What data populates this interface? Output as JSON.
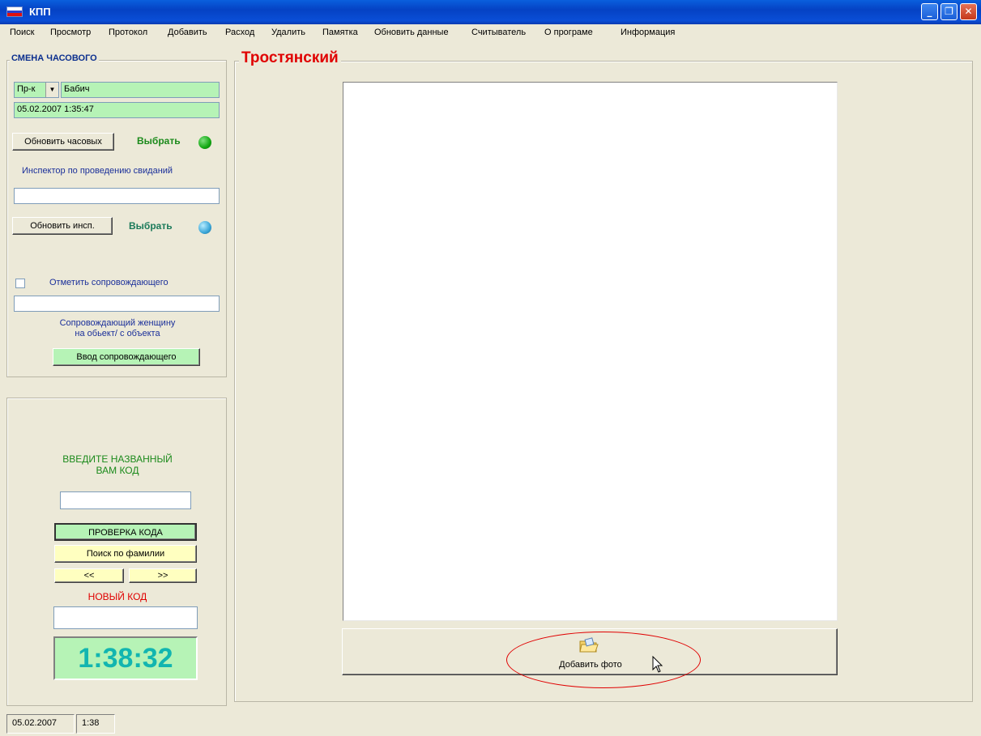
{
  "window": {
    "title": "КПП",
    "flag_colors": [
      "#ffffff",
      "#2b3fd1",
      "#e01010"
    ],
    "controls": {
      "minimize": "_",
      "restore": "❐",
      "close": "✕"
    }
  },
  "menu": [
    "Поиск",
    "Просмотр",
    "Протокол",
    "Добавить",
    "Расход",
    "Удалить",
    "Памятка",
    "Обновить данные",
    "Считыватель",
    "О програме",
    "Информация"
  ],
  "guard_panel": {
    "title": "СМЕНА ЧАСОВОГО",
    "rank_value": "Пр-к",
    "name_value": "Бабич",
    "datetime_value": "05.02.2007 1:35:47",
    "update_guards_button": "Обновить часовых",
    "select_label": "Выбрать",
    "inspector_label": "Инспектор по проведению свиданий",
    "inspector_value": "",
    "update_inspector_button": "Обновить инсп.",
    "select_label_2": "Выбрать",
    "escort_checkbox_label": "Отметить сопровождающего",
    "escort_value": "",
    "escort_note_line1": "Сопровождающий женщину",
    "escort_note_line2": "на обьект/ с объекта",
    "escort_button": "Ввод сопровождающего",
    "led_colors": [
      "#12a812",
      "#3aa6d8"
    ]
  },
  "code_panel": {
    "prompt_line1": "ВВЕДИТЕ НАЗВАННЫЙ",
    "prompt_line2": "ВАМ КОД",
    "code_value": "",
    "check_button": "ПРОВЕРКА КОДА",
    "search_button": "Поиск по фамилии",
    "prev_button": "<<",
    "next_button": ">>",
    "new_code_label": "НОВЫЙ КОД",
    "new_code_value": "",
    "clock": "1:38:32"
  },
  "main": {
    "title": "Тростянский",
    "add_photo_button": "Добавить фото",
    "add_photo_icon": "folder-photo-icon"
  },
  "statusbar": {
    "date": "05.02.2007",
    "time": "1:38"
  },
  "colors": {
    "accent_red": "#e00000",
    "field_green": "#b6f3b6",
    "button_yellow": "#ffffc0",
    "clock_teal": "#12b5b0",
    "title_blue": "#0b2f8e"
  }
}
